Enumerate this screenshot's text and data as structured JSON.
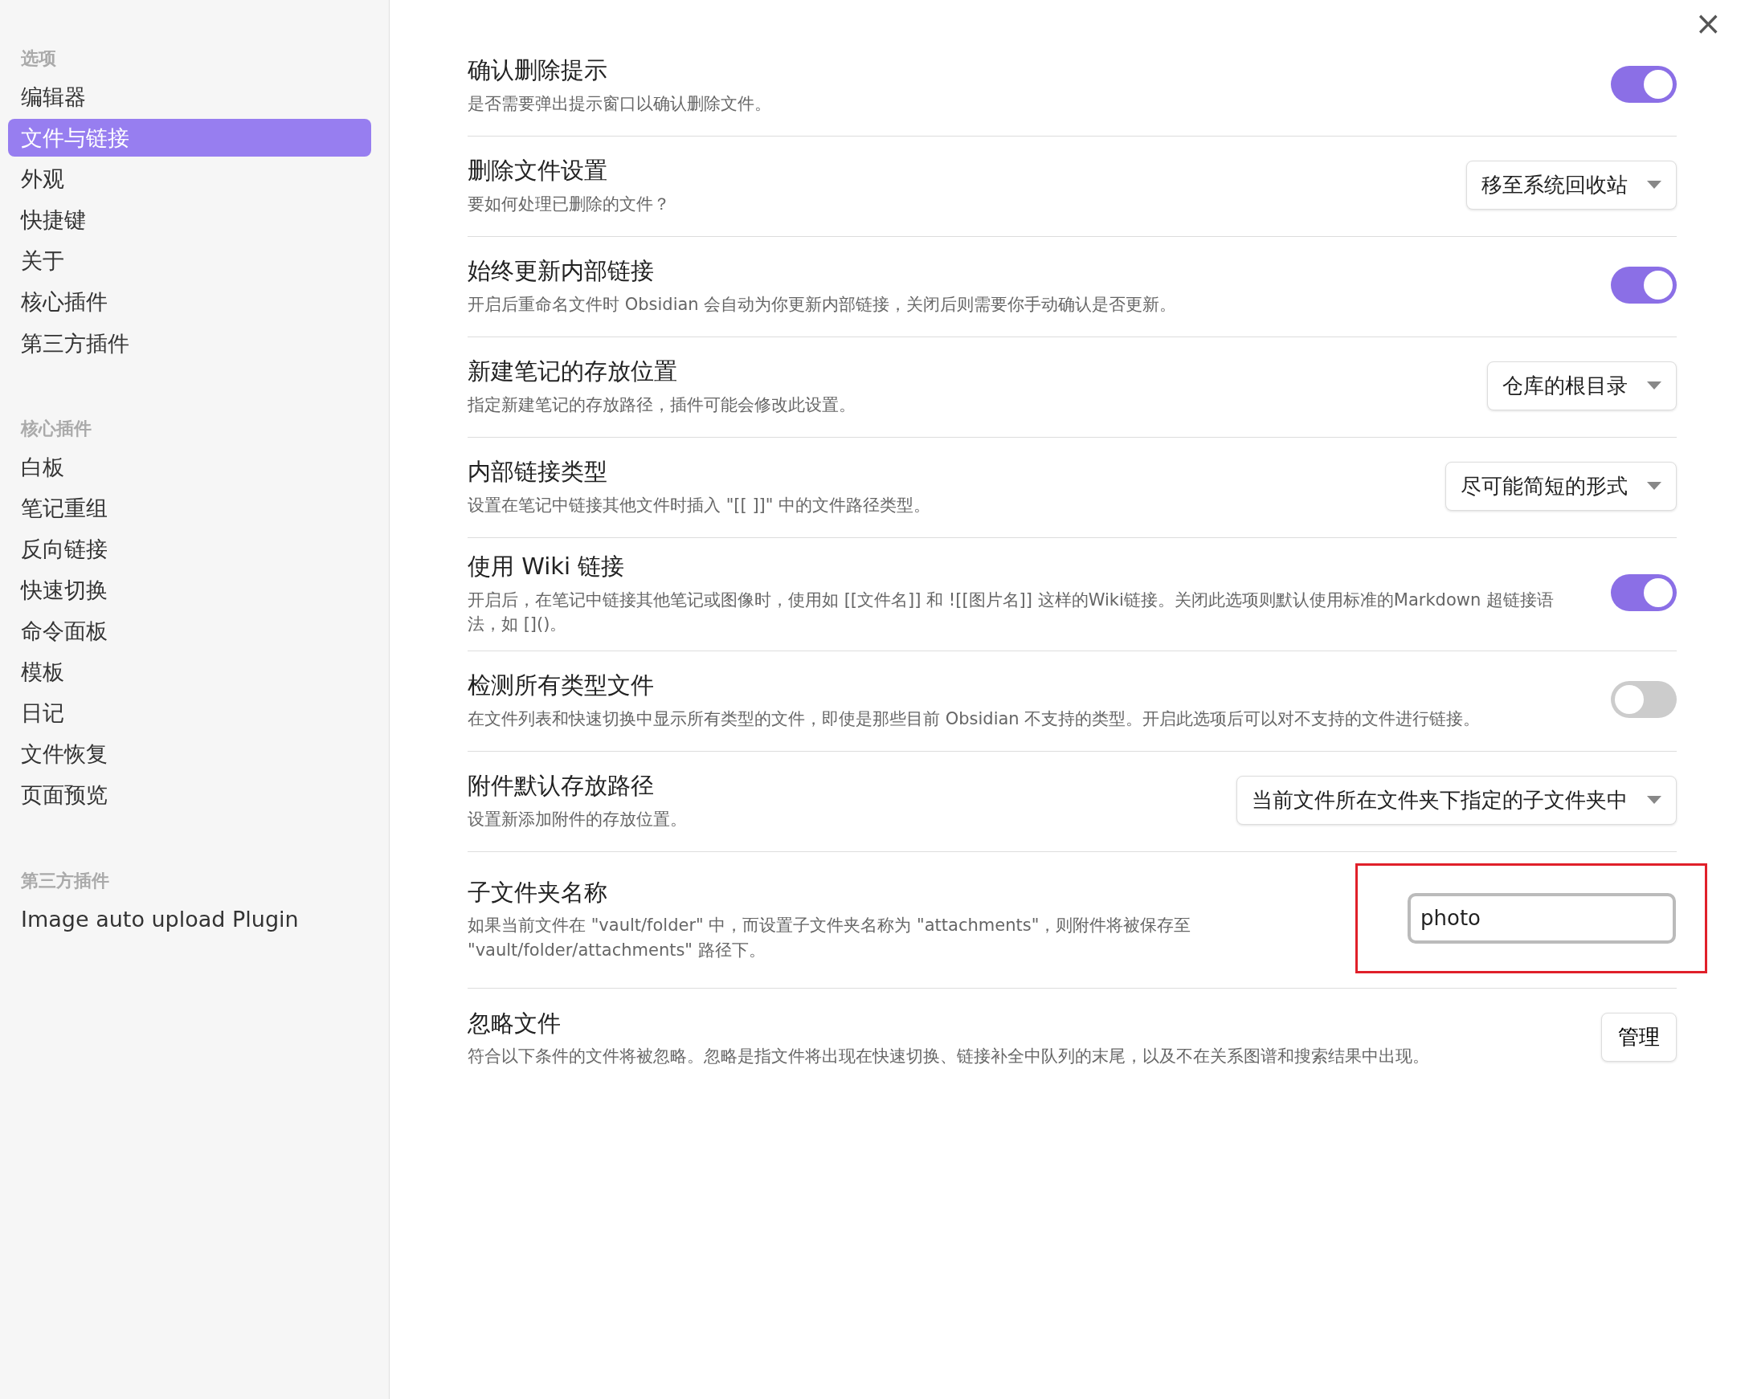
{
  "sidebar": {
    "sections": [
      {
        "heading": "选项",
        "items": [
          {
            "label": "编辑器",
            "selected": false
          },
          {
            "label": "文件与链接",
            "selected": true
          },
          {
            "label": "外观",
            "selected": false
          },
          {
            "label": "快捷键",
            "selected": false
          },
          {
            "label": "关于",
            "selected": false
          },
          {
            "label": "核心插件",
            "selected": false
          },
          {
            "label": "第三方插件",
            "selected": false
          }
        ]
      },
      {
        "heading": "核心插件",
        "items": [
          {
            "label": "白板",
            "selected": false
          },
          {
            "label": "笔记重组",
            "selected": false
          },
          {
            "label": "反向链接",
            "selected": false
          },
          {
            "label": "快速切换",
            "selected": false
          },
          {
            "label": "命令面板",
            "selected": false
          },
          {
            "label": "模板",
            "selected": false
          },
          {
            "label": "日记",
            "selected": false
          },
          {
            "label": "文件恢复",
            "selected": false
          },
          {
            "label": "页面预览",
            "selected": false
          }
        ]
      },
      {
        "heading": "第三方插件",
        "items": [
          {
            "label": "Image auto upload Plugin",
            "selected": false
          }
        ]
      }
    ]
  },
  "close_button": "×",
  "settings": [
    {
      "kind": "toggle",
      "title": "确认删除提示",
      "description": "是否需要弹出提示窗口以确认删除文件。",
      "on": true
    },
    {
      "kind": "dropdown",
      "title": "删除文件设置",
      "description": "要如何处理已删除的文件？",
      "value": "移至系统回收站"
    },
    {
      "kind": "toggle",
      "title": "始终更新内部链接",
      "description": "开启后重命名文件时 Obsidian 会自动为你更新内部链接，关闭后则需要你手动确认是否更新。",
      "on": true
    },
    {
      "kind": "dropdown",
      "title": "新建笔记的存放位置",
      "description": "指定新建笔记的存放路径，插件可能会修改此设置。",
      "value": "仓库的根目录"
    },
    {
      "kind": "dropdown",
      "title": "内部链接类型",
      "description": "设置在笔记中链接其他文件时插入 \"[[ ]]\" 中的文件路径类型。",
      "value": "尽可能简短的形式"
    },
    {
      "kind": "toggle",
      "title": "使用 Wiki 链接",
      "description": "开启后，在笔记中链接其他笔记或图像时，使用如 [[文件名]] 和 ![[图片名]] 这样的Wiki链接。关闭此选项则默认使用标准的Markdown 超链接语法，如 []()。",
      "on": true
    },
    {
      "kind": "toggle",
      "title": "检测所有类型文件",
      "description": "在文件列表和快速切换中显示所有类型的文件，即使是那些目前 Obsidian 不支持的类型。开启此选项后可以对不支持的文件进行链接。",
      "on": false
    },
    {
      "kind": "dropdown",
      "title": "附件默认存放路径",
      "description": "设置新添加附件的存放位置。",
      "value": "当前文件所在文件夹下指定的子文件夹中"
    },
    {
      "kind": "text",
      "title": "子文件夹名称",
      "description": "如果当前文件在 \"vault/folder\" 中，而设置子文件夹名称为 \"attachments\"，则附件将被保存至 \"vault/folder/attachments\" 路径下。",
      "value": "photo",
      "highlighted": true
    },
    {
      "kind": "button",
      "title": "忽略文件",
      "description": "符合以下条件的文件将被忽略。忽略是指文件将出现在快速切换、链接补全中队列的末尾，以及不在关系图谱和搜索结果中出现。",
      "value": "管理"
    }
  ]
}
